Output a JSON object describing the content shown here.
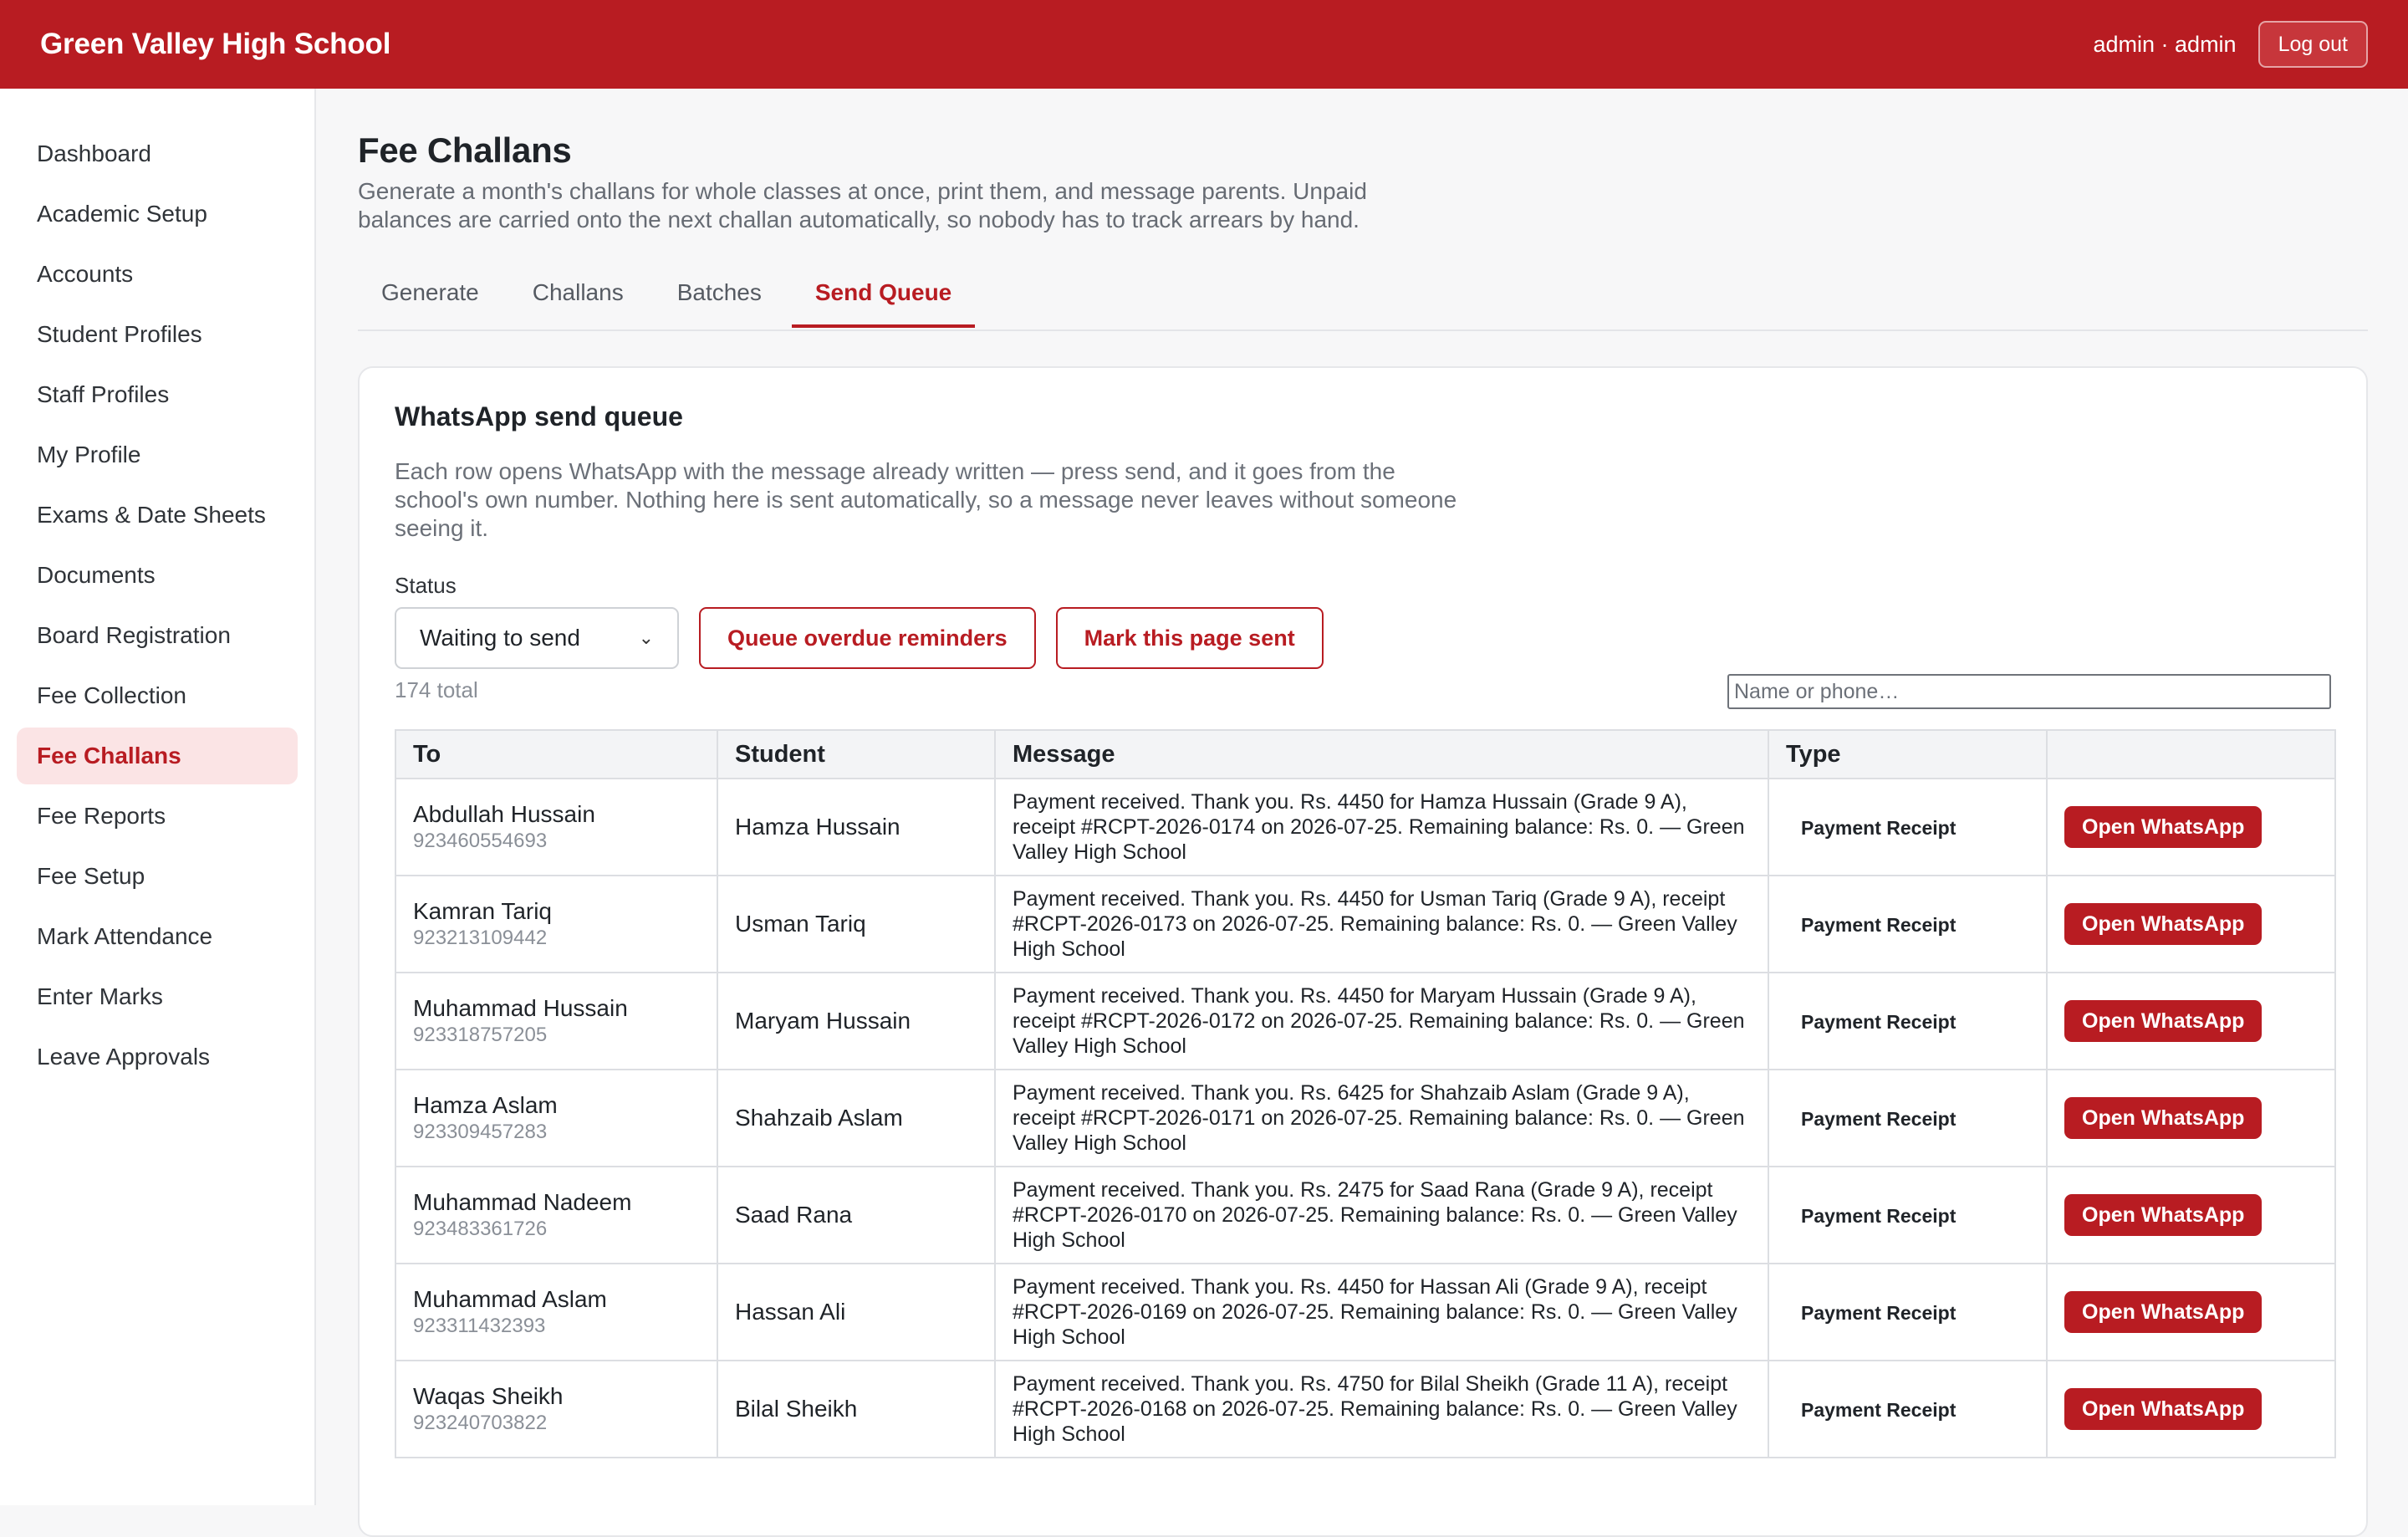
{
  "header": {
    "school_name": "Green Valley High School",
    "user_text": "admin · admin",
    "logout_label": "Log out"
  },
  "sidebar": {
    "items": [
      {
        "label": "Dashboard"
      },
      {
        "label": "Academic Setup"
      },
      {
        "label": "Accounts"
      },
      {
        "label": "Student Profiles"
      },
      {
        "label": "Staff Profiles"
      },
      {
        "label": "My Profile"
      },
      {
        "label": "Exams & Date Sheets"
      },
      {
        "label": "Documents"
      },
      {
        "label": "Board Registration"
      },
      {
        "label": "Fee Collection"
      },
      {
        "label": "Fee Challans",
        "active": true
      },
      {
        "label": "Fee Reports"
      },
      {
        "label": "Fee Setup"
      },
      {
        "label": "Mark Attendance"
      },
      {
        "label": "Enter Marks"
      },
      {
        "label": "Leave Approvals"
      }
    ]
  },
  "page": {
    "title": "Fee Challans",
    "description": "Generate a month's challans for whole classes at once, print them, and message parents. Unpaid balances are carried onto the next challan automatically, so nobody has to track arrears by hand."
  },
  "tabs": [
    {
      "label": "Generate"
    },
    {
      "label": "Challans"
    },
    {
      "label": "Batches"
    },
    {
      "label": "Send Queue",
      "active": true
    }
  ],
  "queue": {
    "title": "WhatsApp send queue",
    "description": "Each row opens WhatsApp with the message already written — press send, and it goes from the school's own number. Nothing here is sent automatically, so a message never leaves without someone seeing it.",
    "status_label": "Status",
    "status_value": "Waiting to send",
    "queue_overdue_label": "Queue overdue reminders",
    "mark_sent_label": "Mark this page sent",
    "total_text": "174 total",
    "search_placeholder": "Name or phone…",
    "columns": {
      "to": "To",
      "student": "Student",
      "message": "Message",
      "type": "Type",
      "action": ""
    },
    "action_label": "Open WhatsApp",
    "rows": [
      {
        "to_name": "Abdullah Hussain",
        "phone": "923460554693",
        "student": "Hamza Hussain",
        "message": "Payment received. Thank you. Rs. 4450 for Hamza Hussain (Grade 9 A), receipt #RCPT-2026-0174 on 2026-07-25. Remaining balance: Rs. 0. — Green Valley High School",
        "type": "Payment Receipt"
      },
      {
        "to_name": "Kamran Tariq",
        "phone": "923213109442",
        "student": "Usman Tariq",
        "message": "Payment received. Thank you. Rs. 4450 for Usman Tariq (Grade 9 A), receipt #RCPT-2026-0173 on 2026-07-25. Remaining balance: Rs. 0. — Green Valley High School",
        "type": "Payment Receipt"
      },
      {
        "to_name": "Muhammad Hussain",
        "phone": "923318757205",
        "student": "Maryam Hussain",
        "message": "Payment received. Thank you. Rs. 4450 for Maryam Hussain (Grade 9 A), receipt #RCPT-2026-0172 on 2026-07-25. Remaining balance: Rs. 0. — Green Valley High School",
        "type": "Payment Receipt"
      },
      {
        "to_name": "Hamza Aslam",
        "phone": "923309457283",
        "student": "Shahzaib Aslam",
        "message": "Payment received. Thank you. Rs. 6425 for Shahzaib Aslam (Grade 9 A), receipt #RCPT-2026-0171 on 2026-07-25. Remaining balance: Rs. 0. — Green Valley High School",
        "type": "Payment Receipt"
      },
      {
        "to_name": "Muhammad Nadeem",
        "phone": "923483361726",
        "student": "Saad Rana",
        "message": "Payment received. Thank you. Rs. 2475 for Saad Rana (Grade 9 A), receipt #RCPT-2026-0170 on 2026-07-25. Remaining balance: Rs. 0. — Green Valley High School",
        "type": "Payment Receipt"
      },
      {
        "to_name": "Muhammad Aslam",
        "phone": "923311432393",
        "student": "Hassan Ali",
        "message": "Payment received. Thank you. Rs. 4450 for Hassan Ali (Grade 9 A), receipt #RCPT-2026-0169 on 2026-07-25. Remaining balance: Rs. 0. — Green Valley High School",
        "type": "Payment Receipt"
      },
      {
        "to_name": "Waqas Sheikh",
        "phone": "923240703822",
        "student": "Bilal Sheikh",
        "message": "Payment received. Thank you. Rs. 4750 for Bilal Sheikh (Grade 11 A), receipt #RCPT-2026-0168 on 2026-07-25. Remaining balance: Rs. 0. — Green Valley High School",
        "type": "Payment Receipt"
      }
    ]
  },
  "colors": {
    "brand": "#b81c22",
    "active_nav_bg": "#fbe4e5"
  }
}
